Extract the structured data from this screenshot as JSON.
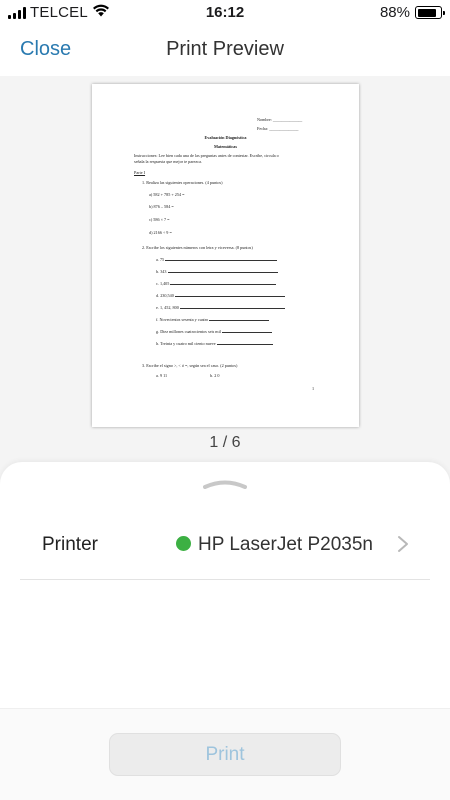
{
  "status_bar": {
    "carrier": "TELCEL",
    "time": "16:12",
    "battery_percent": "88%",
    "battery_level": 0.88,
    "icons": [
      "signal-icon",
      "wifi-icon",
      "battery-icon"
    ]
  },
  "nav": {
    "close_label": "Close",
    "title": "Print Preview"
  },
  "preview": {
    "page_counter": "1 / 6",
    "document": {
      "name_label": "Nombre: ______________",
      "date_label": "Fecha: ______________",
      "title": "Evaluación Diagnóstica",
      "subject": "Matemáticas",
      "instructions_1": "Instrucciones: Lee bien cada una de las preguntas antes de contestar. Escribe, circula o",
      "instructions_2": "señala la respuesta que mejor te parezca.",
      "part": "Parte I",
      "q1": "1.  Realiza las siguientes operaciones. (4 puntos)",
      "q1a": "a)  582 + 785 + 254 =",
      "q1b": "b)  876 – 584 =",
      "q1c": "c)  586 × 7 =",
      "q1d": "d)  2166 ÷ 9 =",
      "q2": "2.  Escribe los siguientes números con letra y viceversa. (8 puntos)",
      "q2a": "a.  75",
      "q2b": "b.  343",
      "q2c": "c.  1,405",
      "q2d": "d.  230,540",
      "q2e": "e.  1, 452, 800",
      "q2f": "f.  Novecientos sesenta y cuatro",
      "q2g": "g.  Diez millones cuatrocientos seis mil",
      "q2h": "h.  Treinta y cuatro mil ciento nueve",
      "q3": "3.  Escribe el signo >, < ó =, según sea el caso. (2 puntos)",
      "q3a": "a.  9        11",
      "q3b": "b.  2    0",
      "page_number": "1"
    }
  },
  "sheet": {
    "printer_label": "Printer",
    "printer_name": "HP LaserJet P2035n",
    "printer_status_color": "#3cb043",
    "print_label": "Print"
  },
  "colors": {
    "accent": "#2a7ab0",
    "print_disabled_text": "#9ec4dd"
  }
}
